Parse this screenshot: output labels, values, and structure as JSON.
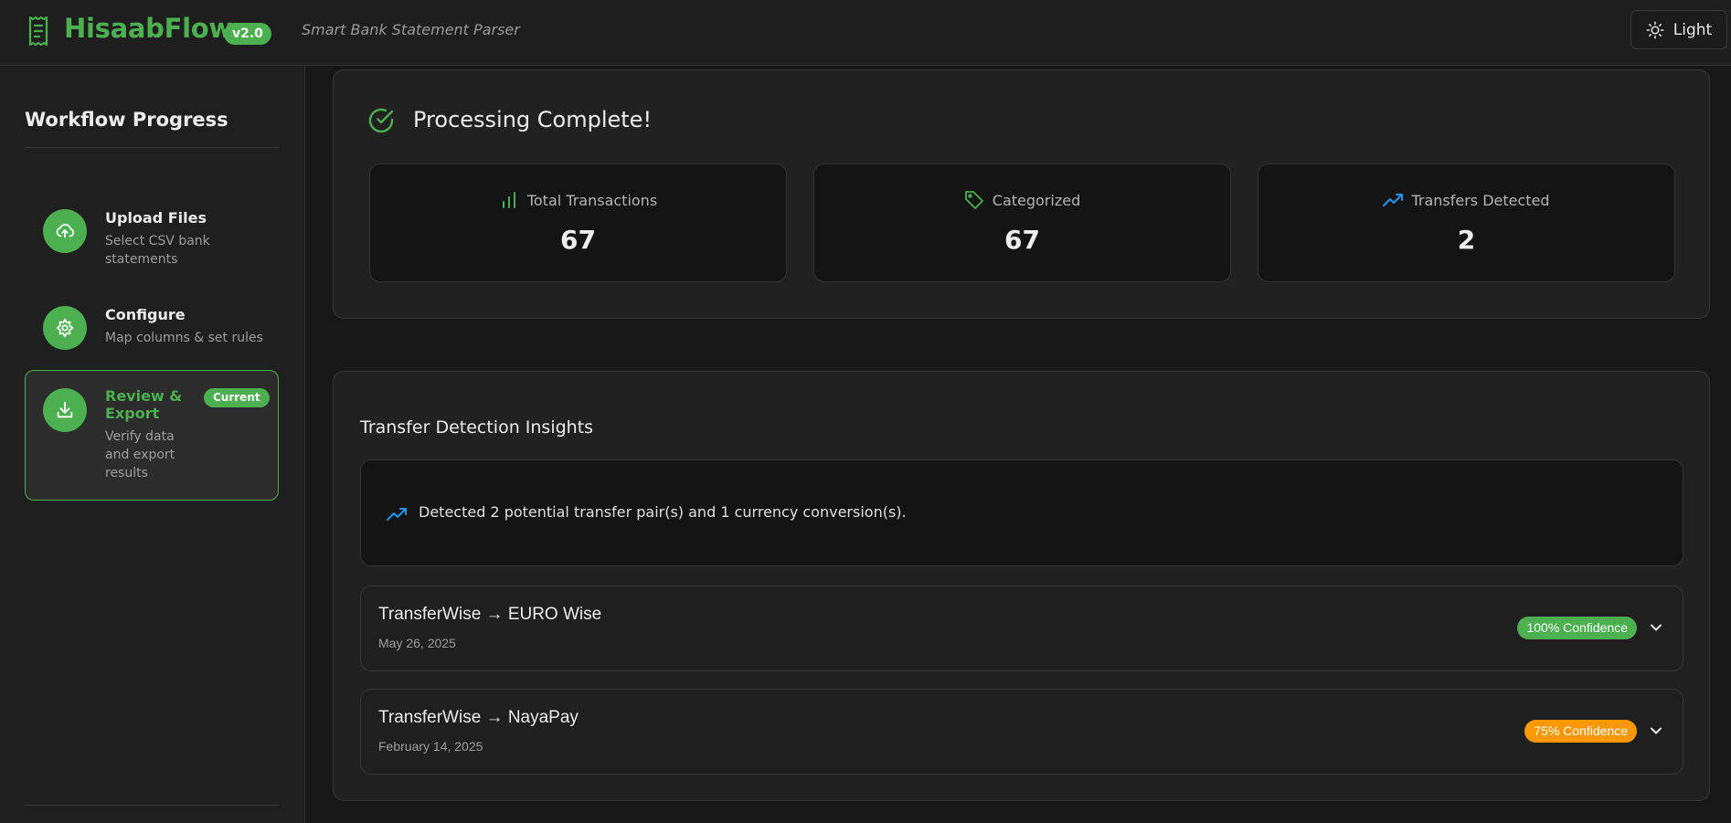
{
  "app": {
    "name": "HisaabFlow",
    "version": "v2.0",
    "subtitle": "Smart Bank Statement Parser",
    "theme_toggle_label": "Light",
    "accent_color": "#4caf50"
  },
  "sidebar": {
    "title": "Workflow Progress",
    "steps": [
      {
        "title": "Upload Files",
        "description": "Select CSV bank statements",
        "icon": "cloud-upload-icon"
      },
      {
        "title": "Configure",
        "description": "Map columns & set rules",
        "icon": "settings-cog-icon"
      },
      {
        "title": "Review & Export",
        "description": "Verify data and export results",
        "icon": "download-icon",
        "badge": "Current"
      }
    ]
  },
  "summary": {
    "title": "Processing Complete!",
    "stats": [
      {
        "label": "Total Transactions",
        "value": "67",
        "icon": "bar-chart-icon"
      },
      {
        "label": "Categorized",
        "value": "67",
        "icon": "tag-icon"
      },
      {
        "label": "Transfers Detected",
        "value": "2",
        "icon": "trending-up-icon"
      }
    ]
  },
  "insights": {
    "title": "Transfer Detection Insights",
    "summary_text": "Detected 2 potential transfer pair(s) and 1 currency conversion(s).",
    "transfers": [
      {
        "title": "TransferWise → EURO Wise",
        "date": "May 26, 2025",
        "confidence": "100% Confidence",
        "confidence_color": "#4caf50"
      },
      {
        "title": "TransferWise → NayaPay",
        "date": "February 14, 2025",
        "confidence": "75% Confidence",
        "confidence_color": "#ff9800"
      }
    ]
  }
}
